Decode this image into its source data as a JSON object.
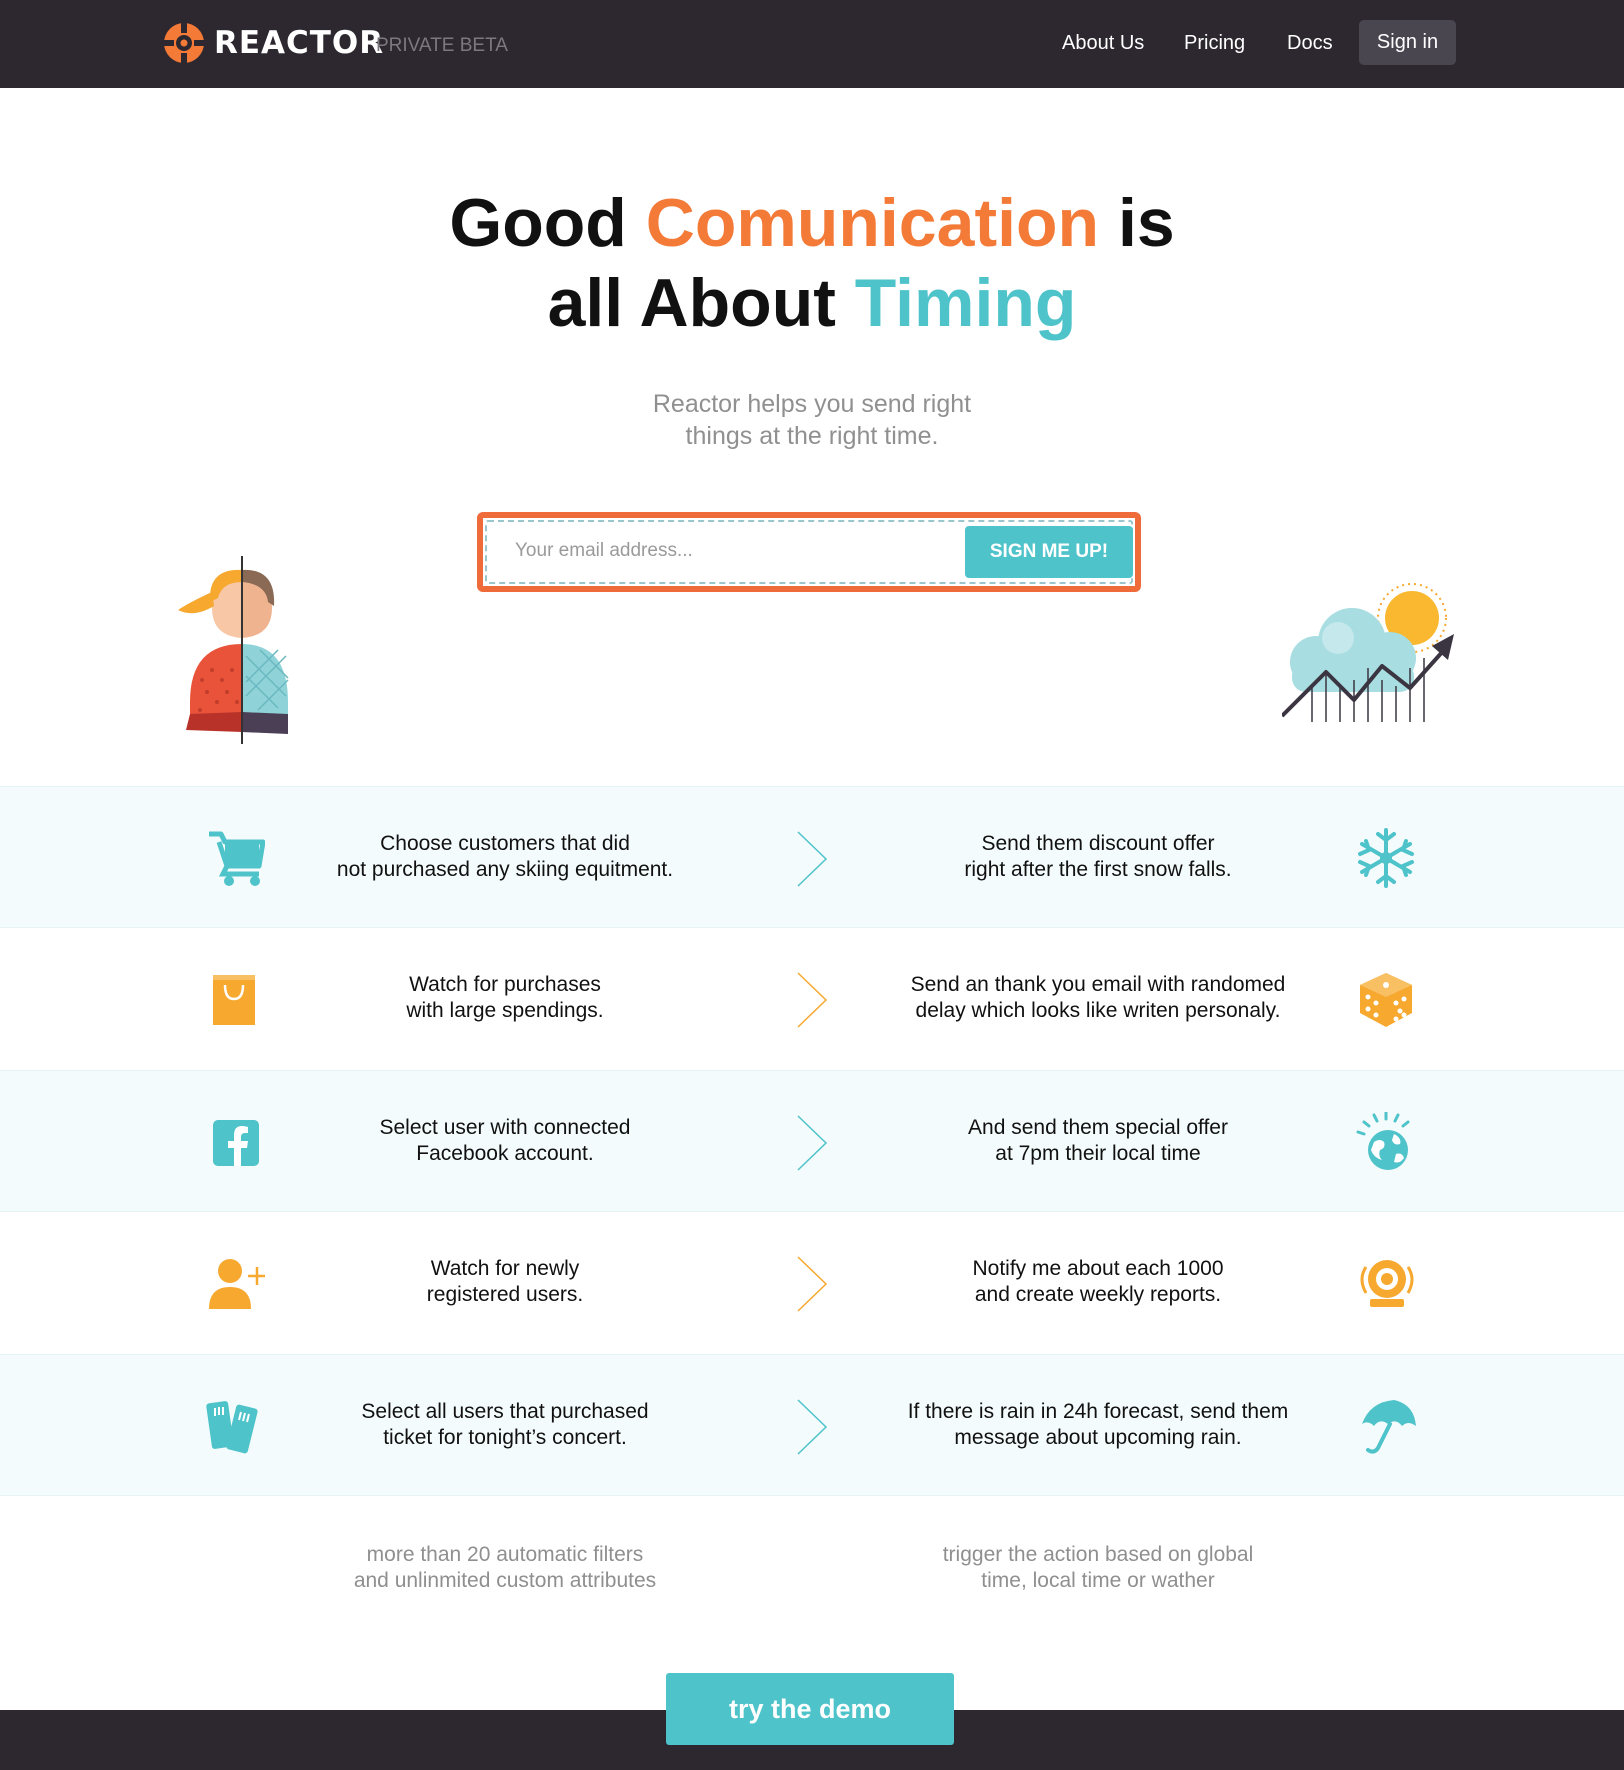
{
  "header": {
    "brand": "REACTOR",
    "beta": "PRIVATE BETA",
    "nav": {
      "about": "About Us",
      "pricing": "Pricing",
      "docs": "Docs",
      "signin": "Sign in"
    }
  },
  "hero": {
    "headline": {
      "part1": "Good ",
      "highlight1": "Comunication",
      "part2": " is",
      "part3": "all About ",
      "highlight2": "Timing"
    },
    "subtitle_line1": "Reactor helps you send right",
    "subtitle_line2": "things at the right time.",
    "email_placeholder": "Your email address...",
    "signup_label": "SIGN ME UP!"
  },
  "rows": [
    {
      "left_icon": "shopping-cart-icon",
      "left_line1": "Choose customers that did",
      "left_line2": "not purchased any skiing equitment.",
      "right_line1": "Send them discount offer",
      "right_line2": "right after the first snow falls.",
      "right_icon": "snowflake-icon"
    },
    {
      "left_icon": "shopping-bag-icon",
      "left_line1": "Watch for purchases",
      "left_line2": "with large spendings.",
      "right_line1": "Send an thank you email with randomed",
      "right_line2": "delay which looks like writen personaly.",
      "right_icon": "dice-icon"
    },
    {
      "left_icon": "facebook-icon",
      "left_line1": "Select user with connected",
      "left_line2": "Facebook account.",
      "right_line1": "And send them special offer",
      "right_line2": "at 7pm their local time",
      "right_icon": "globe-icon"
    },
    {
      "left_icon": "add-user-icon",
      "left_line1": "Watch for newly",
      "left_line2": "registered users.",
      "right_line1": "Notify me about each 1000",
      "right_line2": "and create weekly reports.",
      "right_icon": "alarm-bell-icon"
    },
    {
      "left_icon": "tickets-icon",
      "left_line1": "Select all users that purchased",
      "left_line2": "ticket for tonight’s concert.",
      "right_line1": "If there is rain in 24h forecast, send them",
      "right_line2": "message about upcoming rain.",
      "right_icon": "umbrella-icon"
    }
  ],
  "captions": {
    "left_line1": "more than 20 automatic filters",
    "left_line2": "and unlinmited custom attributes",
    "right_line1": "trigger the action based on global",
    "right_line2": "time, local time or wather"
  },
  "cta": {
    "demo_label": "try the demo"
  },
  "colors": {
    "header_bg": "#2d2830",
    "accent_orange": "#f47a38",
    "accent_teal": "#4ec3ca",
    "row_shade": "#f4fbfc"
  }
}
